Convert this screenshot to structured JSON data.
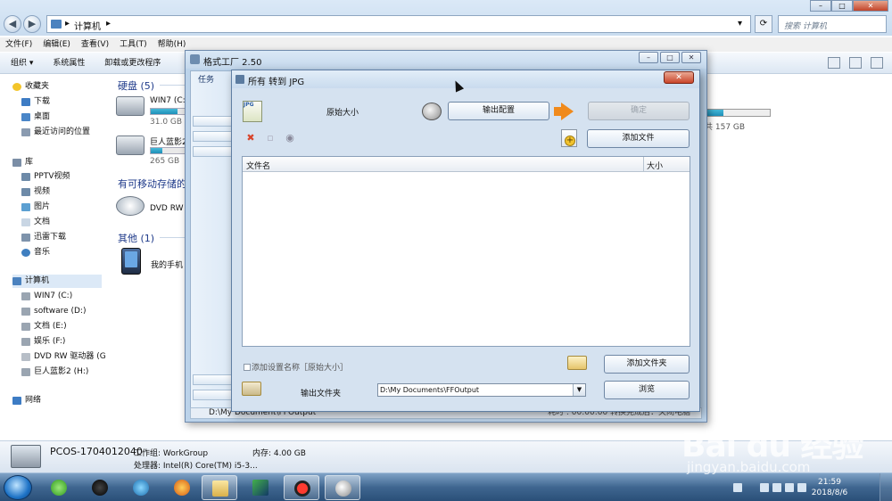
{
  "explorer": {
    "address": [
      "计算机"
    ],
    "search_placeholder": "搜索 计算机",
    "menu": [
      "文件(F)",
      "编辑(E)",
      "查看(V)",
      "工具(T)",
      "帮助(H)"
    ],
    "toolbar": [
      "组织 ▾",
      "系统属性",
      "卸载或更改程序"
    ],
    "sidebar": {
      "favorites": "收藏夹",
      "fav_items": [
        "下载",
        "桌面",
        "最近访问的位置"
      ],
      "libraries": "库",
      "lib_items": [
        "PPTV视频",
        "视频",
        "图片",
        "文档",
        "迅雷下载",
        "音乐"
      ],
      "computer": "计算机",
      "drives": [
        "WIN7 (C:)",
        "software (D:)",
        "文档 (E:)",
        "娱乐 (F:)",
        "DVD RW 驱动器 (G",
        "巨人蓝影2 (H:)"
      ],
      "network": "网络"
    },
    "groups": {
      "hard_disks": "硬盘 (5)",
      "removable": "有可移动存储的",
      "other": "其他 (1)"
    },
    "drives": [
      {
        "name": "WIN7 (C:",
        "size": "31.0 GB",
        "fill": 0.8
      },
      {
        "name": "巨人蓝影2",
        "size": "265 GB",
        "fill": 0.35
      }
    ],
    "right_drive_size": "共 157 GB",
    "right_drive_fill": 0.3,
    "dvd": "DVD RW",
    "phone": "我的手机",
    "details": {
      "pc_name": "PCOS-1704012040",
      "workgroup": "工作组: WorkGroup",
      "memory": "内存: 4.00 GB",
      "cpu": "处理器: Intel(R) Core(TM) i5-3..."
    }
  },
  "formatfactory": {
    "title": "格式工厂 2.50",
    "task_label": "任务",
    "status_left": "D:\\My Document\\FFOutput",
    "status_right": "耗时 : 00:00:00   转换完成后：关闭电脑"
  },
  "dialog": {
    "title": "所有 转到 JPG",
    "close": "✕",
    "original_size": "原始大小",
    "output_settings": "输出配置",
    "ok": "确定",
    "add_file": "添加文件",
    "columns": [
      "文件名",
      "大小"
    ],
    "checkbox_label": "添加设置名称［原始大小］",
    "add_folder": "添加文件夹",
    "output_folder_label": "输出文件夹",
    "output_path": "D:\\My Documents\\FFOutput",
    "browse": "浏览",
    "jpg_badge": "JPG"
  },
  "taskbar": {
    "time": "21:59",
    "date": "2018/8/6"
  },
  "watermark": {
    "brand": "Bai du 经验",
    "url": "jingyan.baidu.com"
  },
  "colors": {
    "accent": "#1e8fb8",
    "close_red": "#c9452a",
    "arrow_orange": "#f08a1c"
  }
}
